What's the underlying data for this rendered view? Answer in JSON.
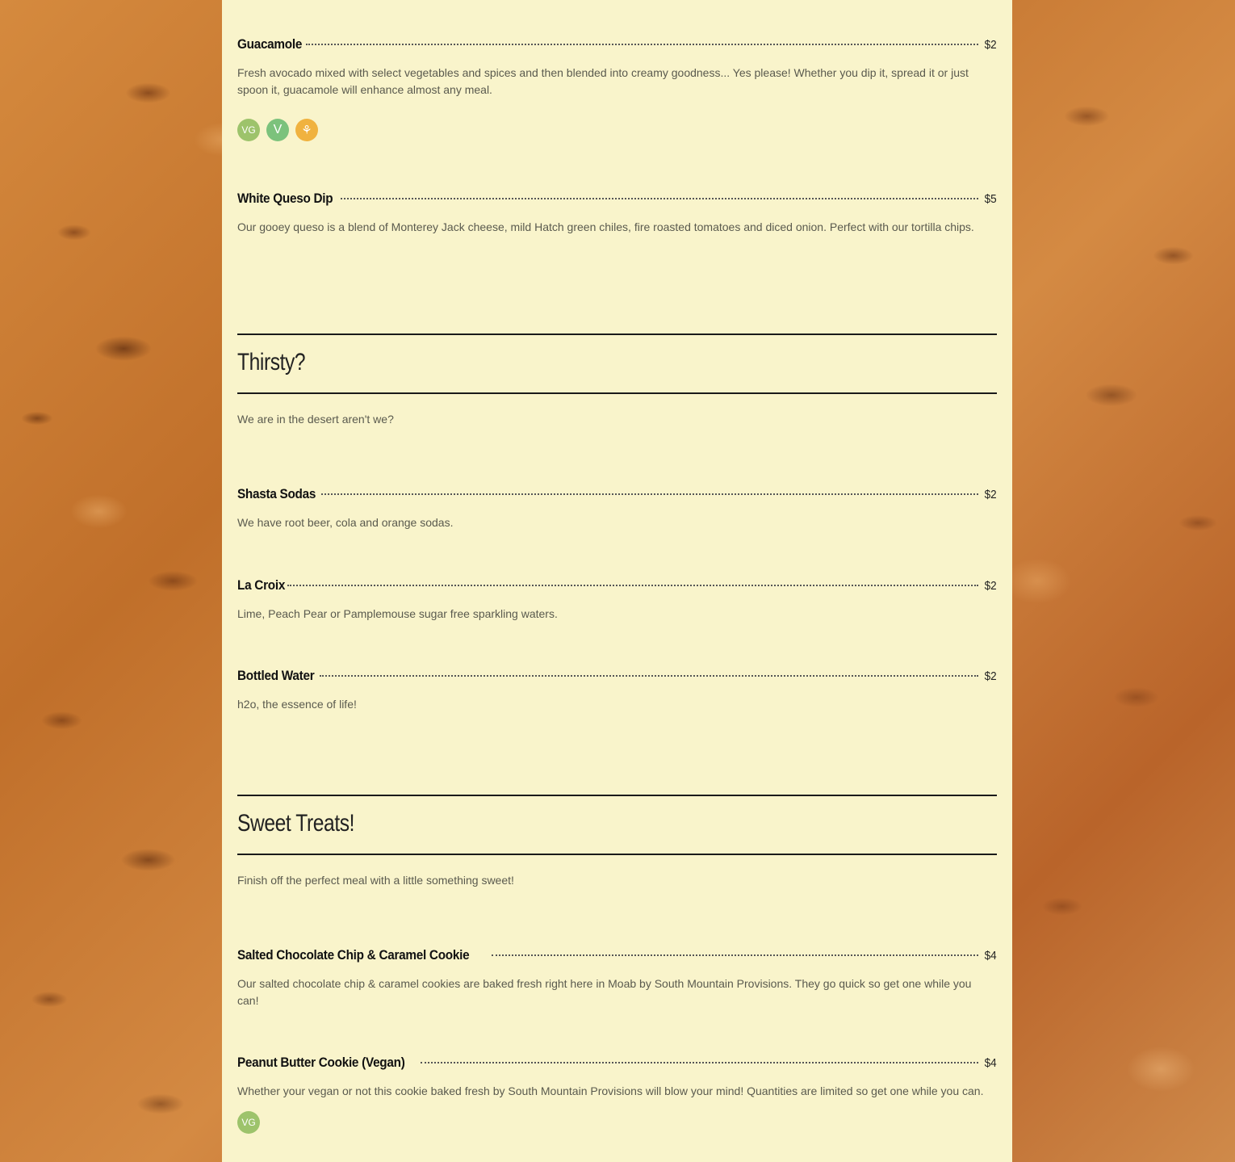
{
  "colors": {
    "panel": "#f9f4cb",
    "heading": "#222222",
    "description": "#5a5a4e",
    "vegan_badge": "#9dc36b",
    "vegetarian_badge": "#7cc27c",
    "gluten_free_badge": "#f0b23f",
    "background": "#c8762e"
  },
  "sections": [
    {
      "items": [
        {
          "name": "Guacamole",
          "price": "$2",
          "description": "Fresh avocado mixed with select vegetables and spices and then blended into creamy goodness... Yes please! Whether you dip it, spread it or just spoon it, guacamole will enhance almost any meal.",
          "badges": [
            {
              "label": "VG",
              "icon": "vegan-icon"
            },
            {
              "label": "V",
              "icon": "vegetarian-icon"
            },
            {
              "label": "⚘",
              "icon": "gluten-free-icon"
            }
          ]
        },
        {
          "name": "White Queso Dip",
          "price": "$5",
          "description": "Our gooey queso is a blend of Monterey Jack cheese, mild Hatch green chiles, fire roasted tomatoes and diced onion. Perfect with our tortilla chips."
        }
      ]
    },
    {
      "title": "Thirsty?",
      "description": "We are in the desert aren't we?",
      "items": [
        {
          "name": "Shasta Sodas",
          "price": "$2",
          "description": "We have root beer, cola and orange sodas."
        },
        {
          "name": "La Croix",
          "price": "$2",
          "description": "Lime, Peach Pear or Pamplemouse sugar free sparkling waters."
        },
        {
          "name": "Bottled Water",
          "price": "$2",
          "description": "h2o, the essence of life!"
        }
      ]
    },
    {
      "title": "Sweet Treats!",
      "description": "Finish off the perfect meal with a little something sweet!",
      "items": [
        {
          "name": "Salted Chocolate Chip & Caramel Cookie",
          "price": "$4",
          "description": "Our salted chocolate chip & caramel cookies are baked fresh right here in Moab by South Mountain Provisions. They go quick so get one while you can!"
        },
        {
          "name": "Peanut Butter Cookie (Vegan)",
          "price": "$4",
          "description": "Whether your vegan or not this cookie baked fresh by South Mountain Provisions will blow your mind! Quantities are limited so get one while you can.",
          "badges": [
            {
              "label": "VG",
              "icon": "vegan-icon"
            }
          ]
        }
      ]
    }
  ]
}
